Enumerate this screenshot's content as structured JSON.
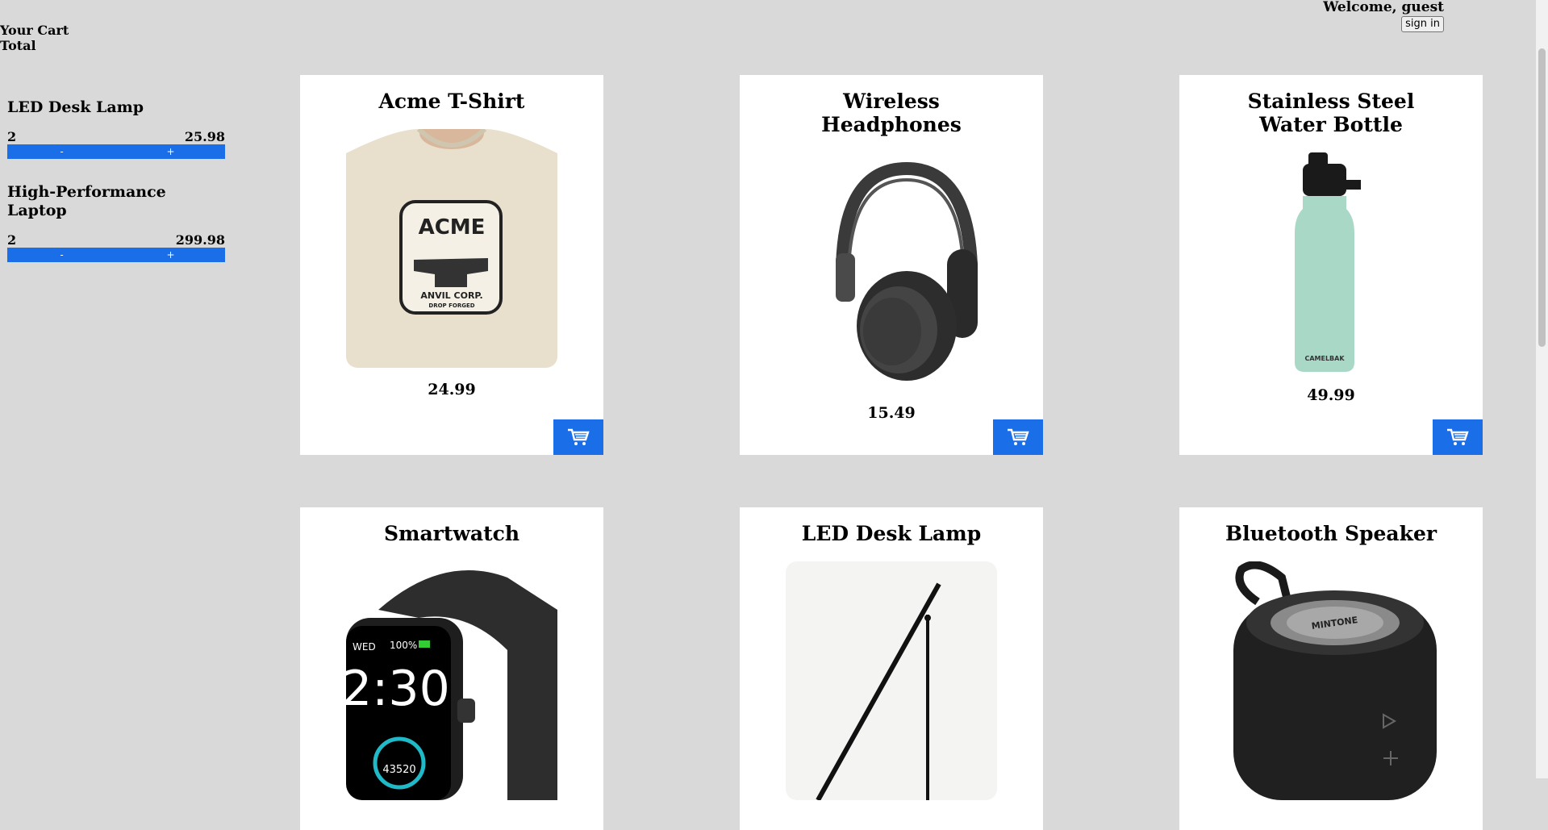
{
  "header": {
    "welcome": "Welcome, guest",
    "signin_label": "sign in"
  },
  "cart": {
    "title": "Your Cart",
    "total_label": "Total",
    "items": [
      {
        "name": "LED Desk Lamp",
        "qty": "2",
        "amount": "25.98",
        "minus": "-",
        "plus": "+"
      },
      {
        "name": "High-Performance Laptop",
        "qty": "2",
        "amount": "299.98",
        "minus": "-",
        "plus": "+"
      }
    ]
  },
  "products": [
    {
      "name": "Acme T-Shirt",
      "price": "24.99",
      "image": "tshirt"
    },
    {
      "name": "Wireless Headphones",
      "price": "15.49",
      "image": "headphones"
    },
    {
      "name": "Stainless Steel Water Bottle",
      "price": "49.99",
      "image": "bottle"
    },
    {
      "name": "Smartwatch",
      "price": "",
      "image": "smartwatch"
    },
    {
      "name": "LED Desk Lamp",
      "price": "",
      "image": "lamp"
    },
    {
      "name": "Bluetooth Speaker",
      "price": "",
      "image": "speaker"
    }
  ],
  "image_text": {
    "tshirt_brand": "ACME",
    "tshirt_sub": "ANVIL CORP.",
    "tshirt_sub2": "DROP FORGED",
    "bottle_brand": "CAMELBAK",
    "watch_day": "WED",
    "watch_battery": "100%",
    "watch_time": "2:30",
    "watch_steps": "43520",
    "speaker_brand": "MINTONE"
  },
  "colors": {
    "accent": "#1a6ee8",
    "background": "#d9d9d9"
  }
}
